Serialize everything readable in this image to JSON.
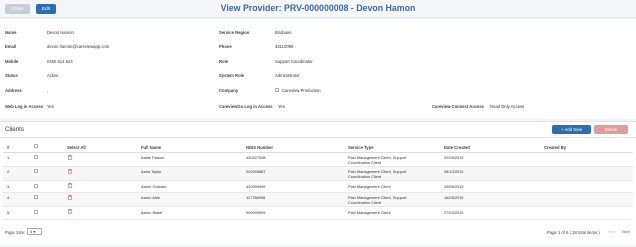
{
  "toolbar": {
    "close_label": "Close",
    "edit_label": "Edit"
  },
  "page_title": "View Provider: PRV-000000008 - Devon Hamon",
  "details": {
    "name_label": "Name",
    "name_value": "Devon Hamon",
    "email_label": "Email",
    "email_value": "devon.hamon@careviewapp.com",
    "mobile_label": "Mobile",
    "mobile_value": "0450 614 523",
    "status_label": "Status",
    "status_value": "Active",
    "address_label": "Address",
    "address_value": ",",
    "weblogin_label": "Web Log in Access",
    "weblogin_value": "Yes",
    "region_label": "Service Region",
    "region_value": "Brisbane",
    "phone_label": "Phone",
    "phone_value": "43110099",
    "role_label": "Role",
    "role_value": "Support Coordinator",
    "sysrole_label": "System Role",
    "sysrole_value": "Administrator",
    "company_label": "Company",
    "company_value": "Careview Production",
    "cvgo_label": "CareviewGo Log in Access",
    "cvgo_value": "Yes",
    "connect_label": "Careview Connect Access",
    "connect_value": "Read Only Access"
  },
  "clients": {
    "title": "Clients",
    "add_label": "+ Add New",
    "delete_label": "Delete",
    "columns": {
      "num": "#",
      "select_all": "Select All",
      "full_name": "Full Name",
      "ndis": "NDIS Number",
      "service_type": "Service Type",
      "date_created": "Date Created",
      "created_by": "Created By"
    },
    "rows": [
      {
        "num": "1.",
        "name": "Aabie Patson",
        "ndis": "430427048",
        "service_line1": "Plan Management Client, Support",
        "service_line2": "Coordination Client",
        "date": "02/08/2019",
        "created_by": ""
      },
      {
        "num": "2.",
        "name": "Aaria Taylor",
        "ndis": "000999887",
        "service_line1": "Plan Management Client, Support",
        "service_line2": "Coordination Client",
        "date": "08/10/2019",
        "created_by": ""
      },
      {
        "num": "3.",
        "name": "Aarne Graham",
        "ndis": "430999999",
        "service_line1": "Plan Management Client",
        "service_line2": "",
        "date": "20/06/2019",
        "created_by": ""
      },
      {
        "num": "4.",
        "name": "Aaron Able",
        "ndis": "117788998",
        "service_line1": "Plan Management Client, Support",
        "service_line2": "Coordination Client",
        "date": "16/08/2019",
        "created_by": ""
      },
      {
        "num": "5.",
        "name": "Aaron Blake",
        "ndis": "909090909",
        "service_line1": "Plan Management Client",
        "service_line2": "",
        "date": "27/03/2019",
        "created_by": ""
      }
    ],
    "pager": {
      "page_size_label": "Page Size:",
      "page_size_value": "5",
      "info": "Page 1 of 6   ( 28 total items )",
      "prev_label": "Prev",
      "next_label": "Next"
    }
  }
}
